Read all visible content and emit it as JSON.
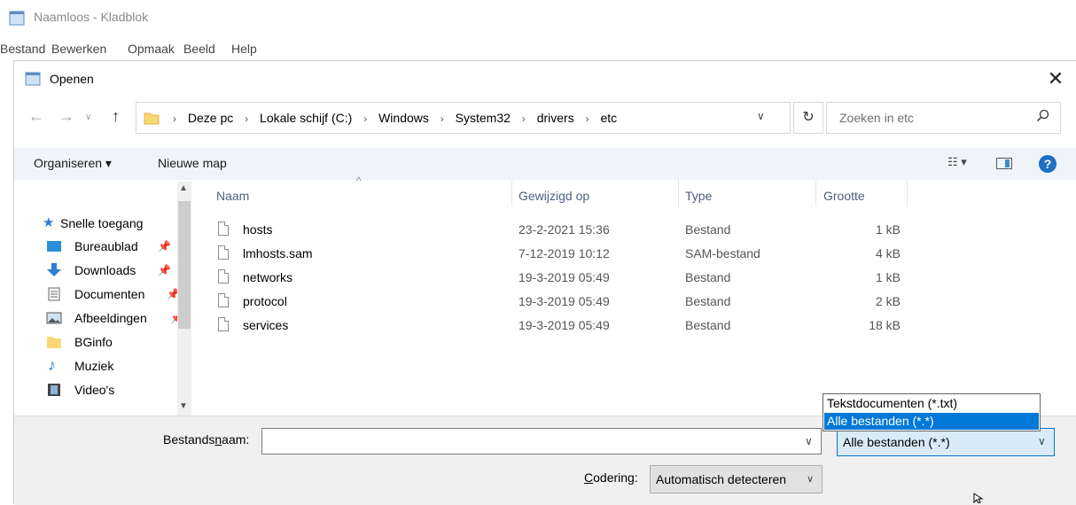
{
  "notepad": {
    "title": "Naamloos - Kladblok",
    "menu": [
      "Bestand",
      "Bewerken",
      "Opmaak",
      "Beeld",
      "Help"
    ]
  },
  "dialog": {
    "title": "Openen",
    "close_glyph": "✕",
    "breadcrumb": [
      "Deze pc",
      "Lokale schijf (C:)",
      "Windows",
      "System32",
      "drivers",
      "etc"
    ],
    "search_placeholder": "Zoeken in etc",
    "toolbar": {
      "organize": "Organiseren ▾",
      "new_folder": "Nieuwe map"
    },
    "sidebar": [
      {
        "label": "Snelle toegang",
        "icon": "star-icon",
        "pinned": false
      },
      {
        "label": "Bureaublad",
        "icon": "desktop-icon",
        "pinned": true
      },
      {
        "label": "Downloads",
        "icon": "download-icon",
        "pinned": true
      },
      {
        "label": "Documenten",
        "icon": "document-icon",
        "pinned": true
      },
      {
        "label": "Afbeeldingen",
        "icon": "image-icon",
        "pinned": true
      },
      {
        "label": "BGinfo",
        "icon": "folder-icon",
        "pinned": false
      },
      {
        "label": "Muziek",
        "icon": "music-icon",
        "pinned": false
      },
      {
        "label": "Video's",
        "icon": "video-icon",
        "pinned": false
      }
    ],
    "columns": {
      "name": "Naam",
      "modified": "Gewijzigd op",
      "type": "Type",
      "size": "Grootte"
    },
    "files": [
      {
        "name": "hosts",
        "modified": "23-2-2021 15:36",
        "type": "Bestand",
        "size": "1 kB"
      },
      {
        "name": "lmhosts.sam",
        "modified": "7-12-2019 10:12",
        "type": "SAM-bestand",
        "size": "4 kB"
      },
      {
        "name": "networks",
        "modified": "19-3-2019 05:49",
        "type": "Bestand",
        "size": "1 kB"
      },
      {
        "name": "protocol",
        "modified": "19-3-2019 05:49",
        "type": "Bestand",
        "size": "2 kB"
      },
      {
        "name": "services",
        "modified": "19-3-2019 05:49",
        "type": "Bestand",
        "size": "18 kB"
      }
    ],
    "filename_label_pre": "Bestands",
    "filename_label_acc": "n",
    "filename_label_post": "aam:",
    "filename_value": "",
    "filetype_selected": "Alle bestanden  (*.*)",
    "filetype_options": [
      "Tekstdocumenten (*.txt)",
      "Alle bestanden  (*.*)"
    ],
    "encoding_label_acc": "C",
    "encoding_label_post": "odering:",
    "encoding_value": "Automatisch detecteren"
  }
}
